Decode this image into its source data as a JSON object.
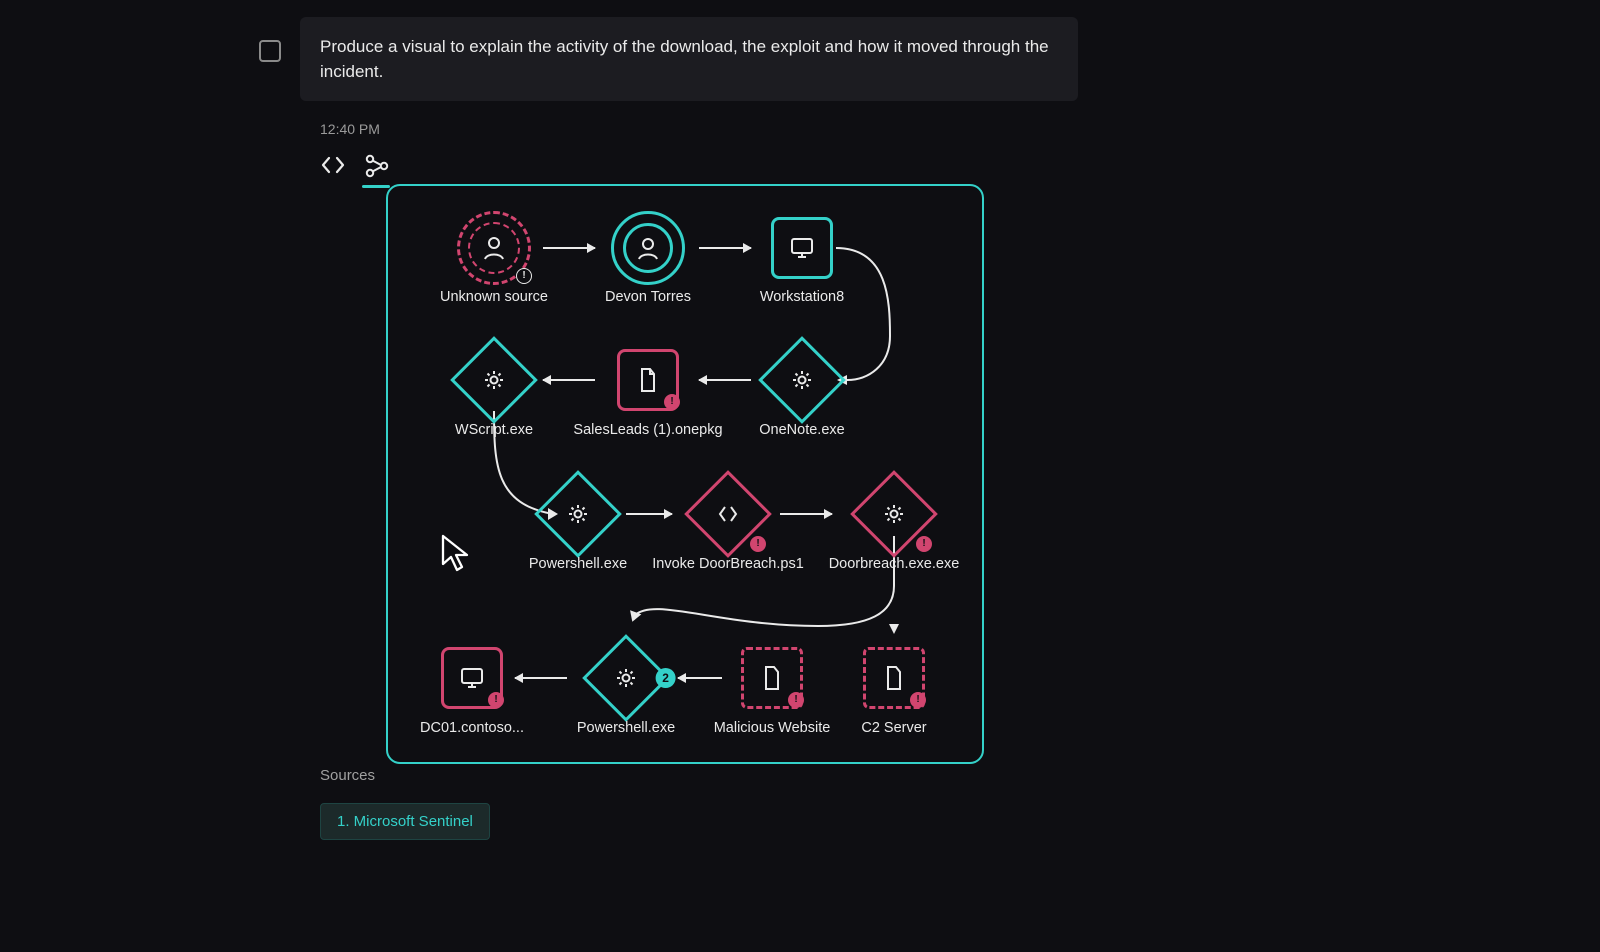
{
  "prompt": "Produce a visual to explain the activity of the download, the exploit and how it moved through the incident.",
  "timestamp": "12:40 PM",
  "tabs": {
    "code": "code-view",
    "graph": "graph-view"
  },
  "nodes": {
    "unknown_source": "Unknown source",
    "devon_torres": "Devon Torres",
    "workstation8": "Workstation8",
    "wscript": "WScript.exe",
    "salesleads": "SalesLeads (1).onepkg",
    "onenote": "OneNote.exe",
    "powershell_a": "Powershell.exe",
    "invoke_db": "Invoke DoorBreach.ps1",
    "doorbreach": "Doorbreach.exe.exe",
    "dc01": "DC01.contoso...",
    "powershell_b": "Powershell.exe",
    "malicious_web": "Malicious Website",
    "c2": "C2 Server"
  },
  "badge_count": "2",
  "sources_label": "Sources",
  "sources": {
    "s1": "1. Microsoft Sentinel"
  },
  "colors": {
    "teal": "#34d1c9",
    "pink": "#d1456f",
    "bg": "#0e0e12"
  }
}
